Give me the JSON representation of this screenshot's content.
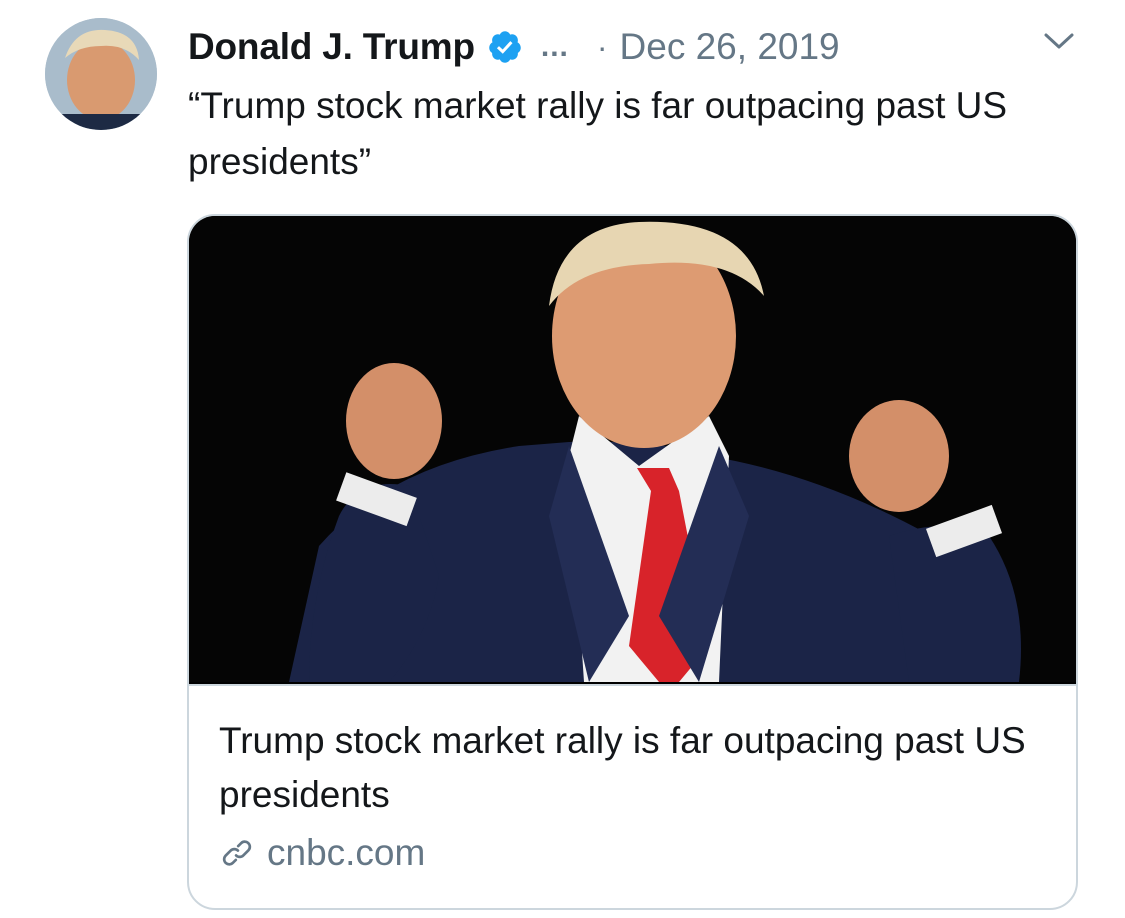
{
  "tweet": {
    "author_name": "Donald J. Trump",
    "more_label": "...",
    "separator": "·",
    "date": "Dec 26, 2019",
    "text": "“Trump stock market rally is far outpacing past US presidents”"
  },
  "card": {
    "title": "Trump stock market rally is far outpacing past US presidents",
    "domain": "cnbc.com"
  },
  "icons": {
    "verified": "verified-badge-icon",
    "caret": "chevron-down-icon",
    "link": "link-icon"
  },
  "colors": {
    "verified_blue": "#1da1f2",
    "secondary_text": "#657786",
    "border": "#ccd6dd",
    "primary_text": "#14171a"
  }
}
